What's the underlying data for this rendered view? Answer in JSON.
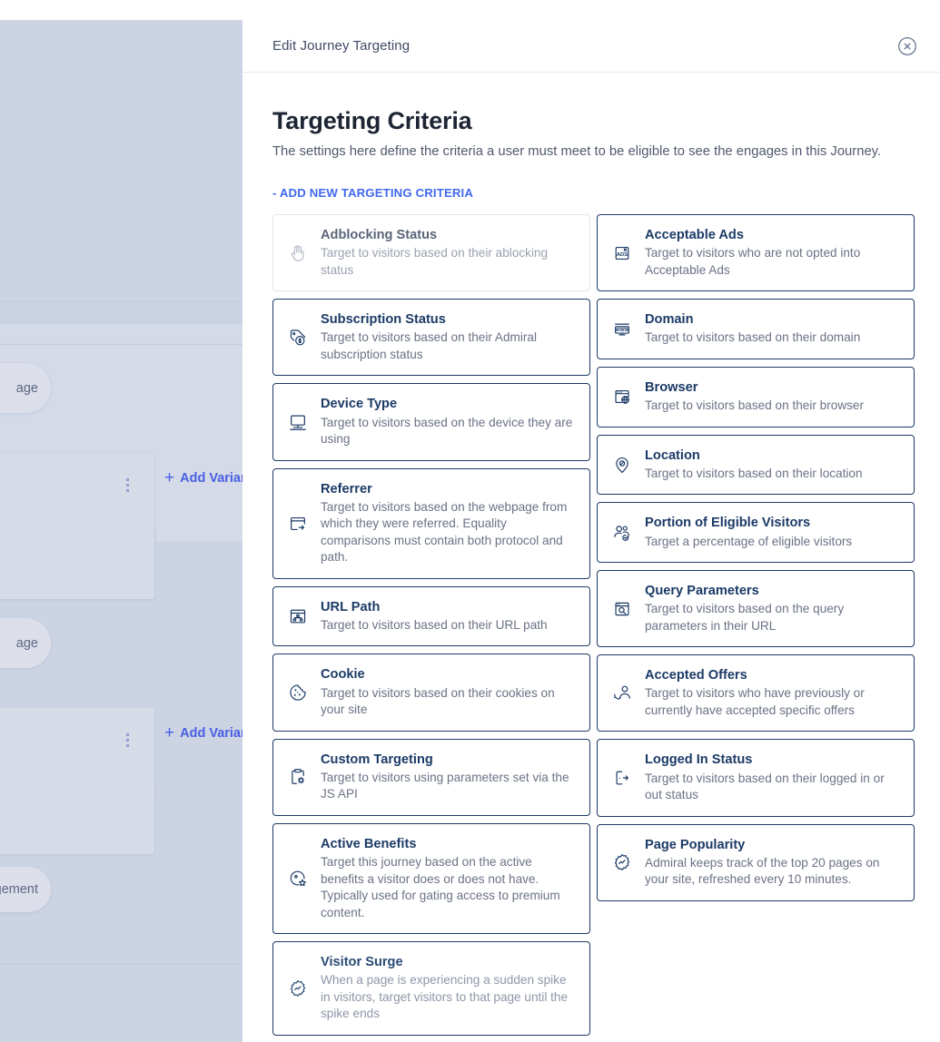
{
  "background": {
    "add_variant_label": "Add Variant",
    "pill_labels": [
      "age",
      "age",
      "gement"
    ]
  },
  "panel": {
    "header_title": "Edit Journey Targeting",
    "close_icon": "close-circle-icon"
  },
  "main": {
    "title": "Targeting Criteria",
    "subtitle": "The settings here define the criteria a user must meet to be eligible to see the engages in this Journey.",
    "add_new_link": "- ADD NEW TARGETING CRITERIA"
  },
  "colors": {
    "accent_link": "#4169f0",
    "card_border": "#1b3a66",
    "card_border_disabled": "#e2e4ea",
    "title_text": "#1d2433",
    "panel_bg": "#ffffff",
    "backdrop": "#ccd4e4"
  },
  "criteria_left": [
    {
      "title": "Adblocking Status",
      "desc": "Target to visitors based on their ablocking status",
      "icon": "hand-raised-icon",
      "state": "disabled"
    },
    {
      "title": "Subscription Status",
      "desc": "Target to visitors based on their Admiral subscription status",
      "icon": "price-tag-dollar-icon",
      "state": "enabled"
    },
    {
      "title": "Device Type",
      "desc": "Target to visitors based on the device they are using",
      "icon": "desktop-monitor-icon",
      "state": "enabled"
    },
    {
      "title": "Referrer",
      "desc": "Target to visitors based on the webpage from which they were referred. Equality comparisons must contain both protocol and path.",
      "icon": "browser-window-arrow-icon",
      "state": "enabled"
    },
    {
      "title": "URL Path",
      "desc": "Target to visitors based on their URL path",
      "icon": "browser-sitemap-icon",
      "state": "enabled"
    },
    {
      "title": "Cookie",
      "desc": "Target to visitors based on their cookies on your site",
      "icon": "cookie-icon",
      "state": "enabled"
    },
    {
      "title": "Custom Targeting",
      "desc": "Target to visitors using parameters set via the JS API",
      "icon": "clipboard-gear-icon",
      "state": "enabled"
    },
    {
      "title": "Active Benefits",
      "desc": "Target this journey based on the active benefits a visitor does or does not have. Typically used for gating access to premium content.",
      "icon": "badge-star-icon",
      "state": "enabled"
    },
    {
      "title": "Visitor Surge",
      "desc": "When a page is experiencing a sudden spike in visitors, target visitors to that page until the spike ends",
      "icon": "burst-chart-icon",
      "state": "faded"
    }
  ],
  "criteria_right": [
    {
      "title": "Acceptable Ads",
      "desc": "Target to visitors who are not opted into Acceptable Ads",
      "icon": "acceptable-ads-icon",
      "state": "enabled"
    },
    {
      "title": "Domain",
      "desc": "Target to visitors based on their domain",
      "icon": "www-monitor-icon",
      "state": "enabled"
    },
    {
      "title": "Browser",
      "desc": "Target to visitors based on their browser",
      "icon": "browser-globe-icon",
      "state": "enabled"
    },
    {
      "title": "Location",
      "desc": "Target to visitors based on their location",
      "icon": "map-pin-icon",
      "state": "enabled"
    },
    {
      "title": "Portion of Eligible Visitors",
      "desc": "Target a percentage of eligible visitors",
      "icon": "users-check-icon",
      "state": "enabled"
    },
    {
      "title": "Query Parameters",
      "desc": "Target to visitors based on the query parameters in their URL",
      "icon": "browser-search-icon",
      "state": "enabled"
    },
    {
      "title": "Accepted Offers",
      "desc": "Target to visitors who have previously or currently have accepted specific offers",
      "icon": "user-hand-icon",
      "state": "enabled"
    },
    {
      "title": "Logged In Status",
      "desc": "Target to visitors based on their logged in or out status",
      "icon": "door-exit-icon",
      "state": "enabled"
    },
    {
      "title": "Page Popularity",
      "desc": "Admiral keeps track of the top 20 pages on your site, refreshed every 10 minutes.",
      "icon": "burst-chart-icon",
      "state": "enabled"
    }
  ]
}
